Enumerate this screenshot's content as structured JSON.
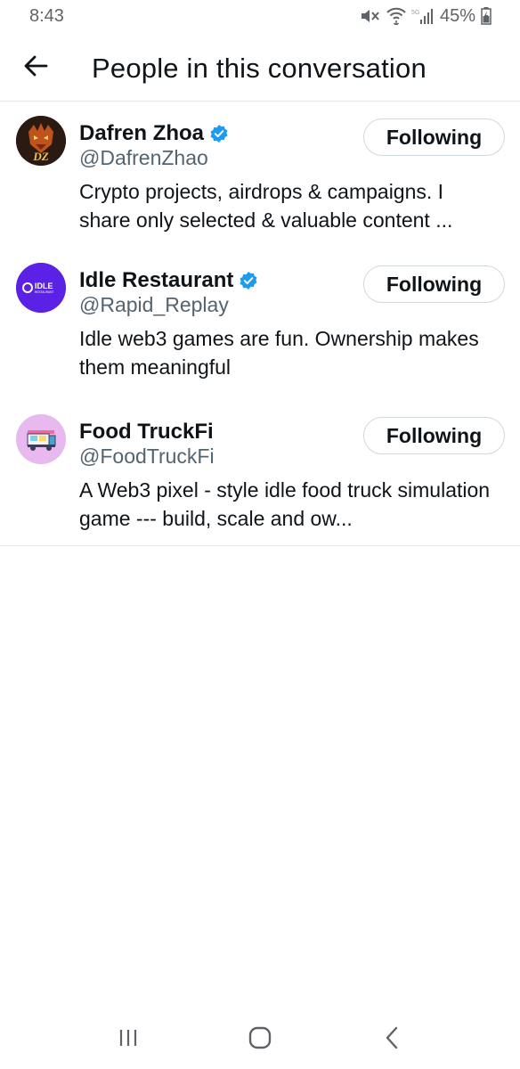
{
  "status_bar": {
    "time": "8:43",
    "battery": "45%",
    "icons": [
      "mute-icon",
      "wifi-icon",
      "signal-icon",
      "battery-icon"
    ]
  },
  "header": {
    "title": "People in this conversation",
    "back_icon": "arrow-left-icon"
  },
  "people": [
    {
      "name": "Dafren Zhoa",
      "handle": "@DafrenZhao",
      "bio": "Crypto projects, airdrops & campaigns. I share only selected & valuable content ...",
      "verified": true,
      "follow_label": "Following",
      "avatar_text": "DZ"
    },
    {
      "name": "Idle Restaurant",
      "handle": "@Rapid_Replay",
      "bio": "Idle web3 games are fun. Ownership makes them meaningful",
      "verified": true,
      "follow_label": "Following",
      "avatar_text": "IDLE",
      "avatar_subtext": "RESTAURANT"
    },
    {
      "name": "Food TruckFi",
      "handle": "@FoodTruckFi",
      "bio": "A Web3 pixel - style idle food truck simulation game --- build, scale and ow...",
      "verified": false,
      "follow_label": "Following"
    }
  ],
  "colors": {
    "verified_blue": "#1d9bf0",
    "secondary_text": "#536471",
    "divider": "#e6e9ec",
    "idle_purple": "#5b21e6",
    "food_pink": "#e8b9ee"
  },
  "nav": [
    "recent-apps-icon",
    "home-icon",
    "back-icon"
  ]
}
